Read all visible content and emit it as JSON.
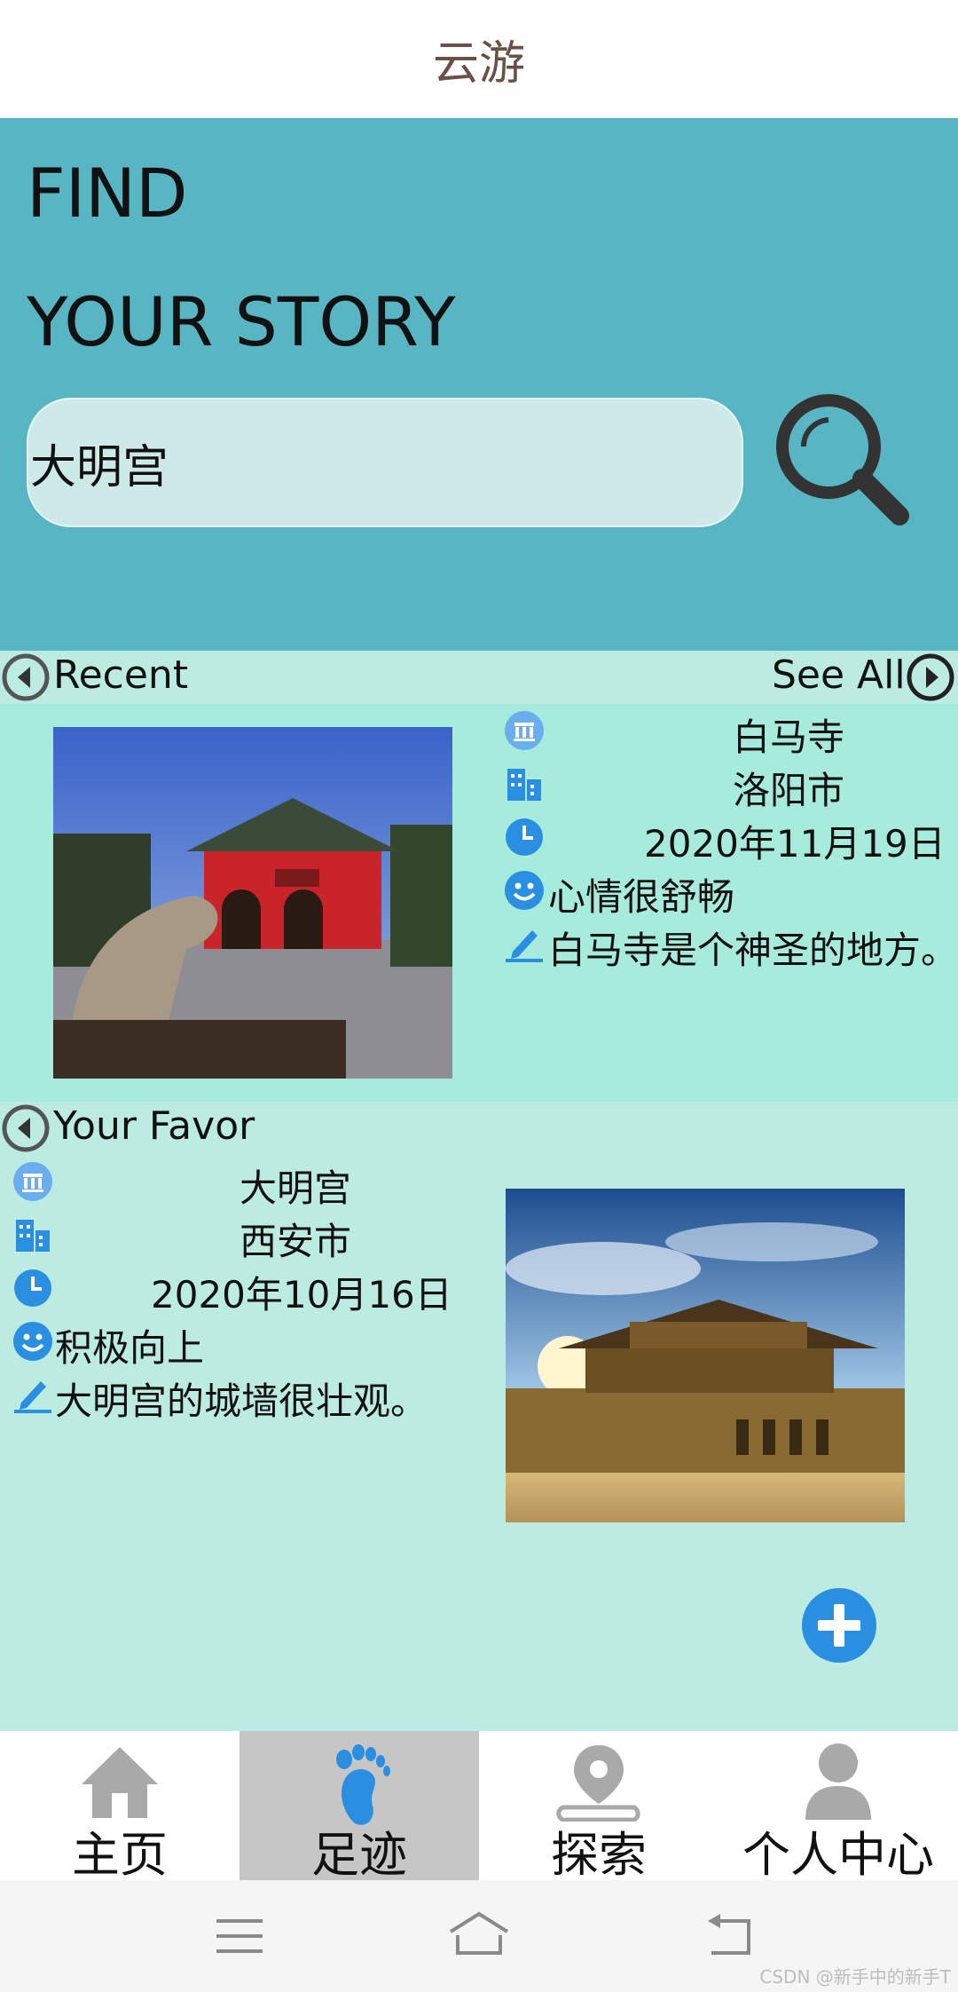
{
  "app_title": "云游",
  "hero": {
    "line1": "FIND",
    "line2": "YOUR STORY",
    "search_value": "大明宫"
  },
  "recent": {
    "title": "Recent",
    "see_all": "See All",
    "name": "白马寺",
    "city": "洛阳市",
    "date": "2020年11月19日",
    "mood": "心情很舒畅",
    "note": "白马寺是个神圣的地方。"
  },
  "favor": {
    "title": "Your Favor",
    "name": "大明宫",
    "city": "西安市",
    "date": "2020年10月16日",
    "mood": "积极向上",
    "note": "大明宫的城墙很壮观。"
  },
  "nav": [
    "主页",
    "足迹",
    "探索",
    "个人中心"
  ],
  "watermark": "CSDN @新手中的新手T",
  "colors": {
    "hero": "#58b6c4",
    "section": "#bcebe1",
    "recent": "#a7ebdc",
    "icon_blue": "#2a8fe0",
    "active_tab": "#c6c6c6"
  }
}
